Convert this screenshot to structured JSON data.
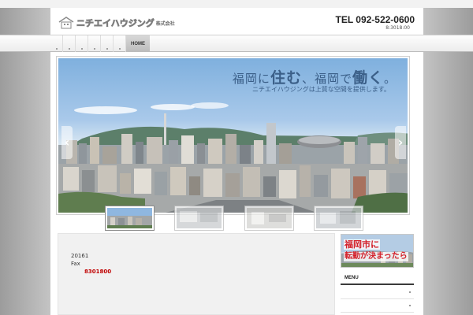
{
  "header": {
    "logo_text": "ニチエイハウジング",
    "logo_sub": "株式会社",
    "tel": "TEL 092-522-0600",
    "hours": "8:3018:00"
  },
  "nav": {
    "home_label": "HOME",
    "item_count": 6
  },
  "slider": {
    "headline_1": "福岡に",
    "headline_big_1": "住む",
    "headline_2": "、福岡で",
    "headline_big_2": "働く",
    "headline_3": "。",
    "subline": "ニチエイハウジングは上質な空間を提供します。",
    "prev_icon": "chevron-left-icon",
    "next_icon": "chevron-right-icon"
  },
  "content": {
    "line1": "20161",
    "line2": "Fax",
    "line3": "8301800"
  },
  "sidebar": {
    "banner_line1": "福岡市に",
    "banner_line2": "転勤が決まったら",
    "menu_title": "MENU"
  },
  "colors": {
    "accent_red": "#d3202a",
    "headline_blue": "#3b5f88",
    "fax_red": "#c00000"
  }
}
